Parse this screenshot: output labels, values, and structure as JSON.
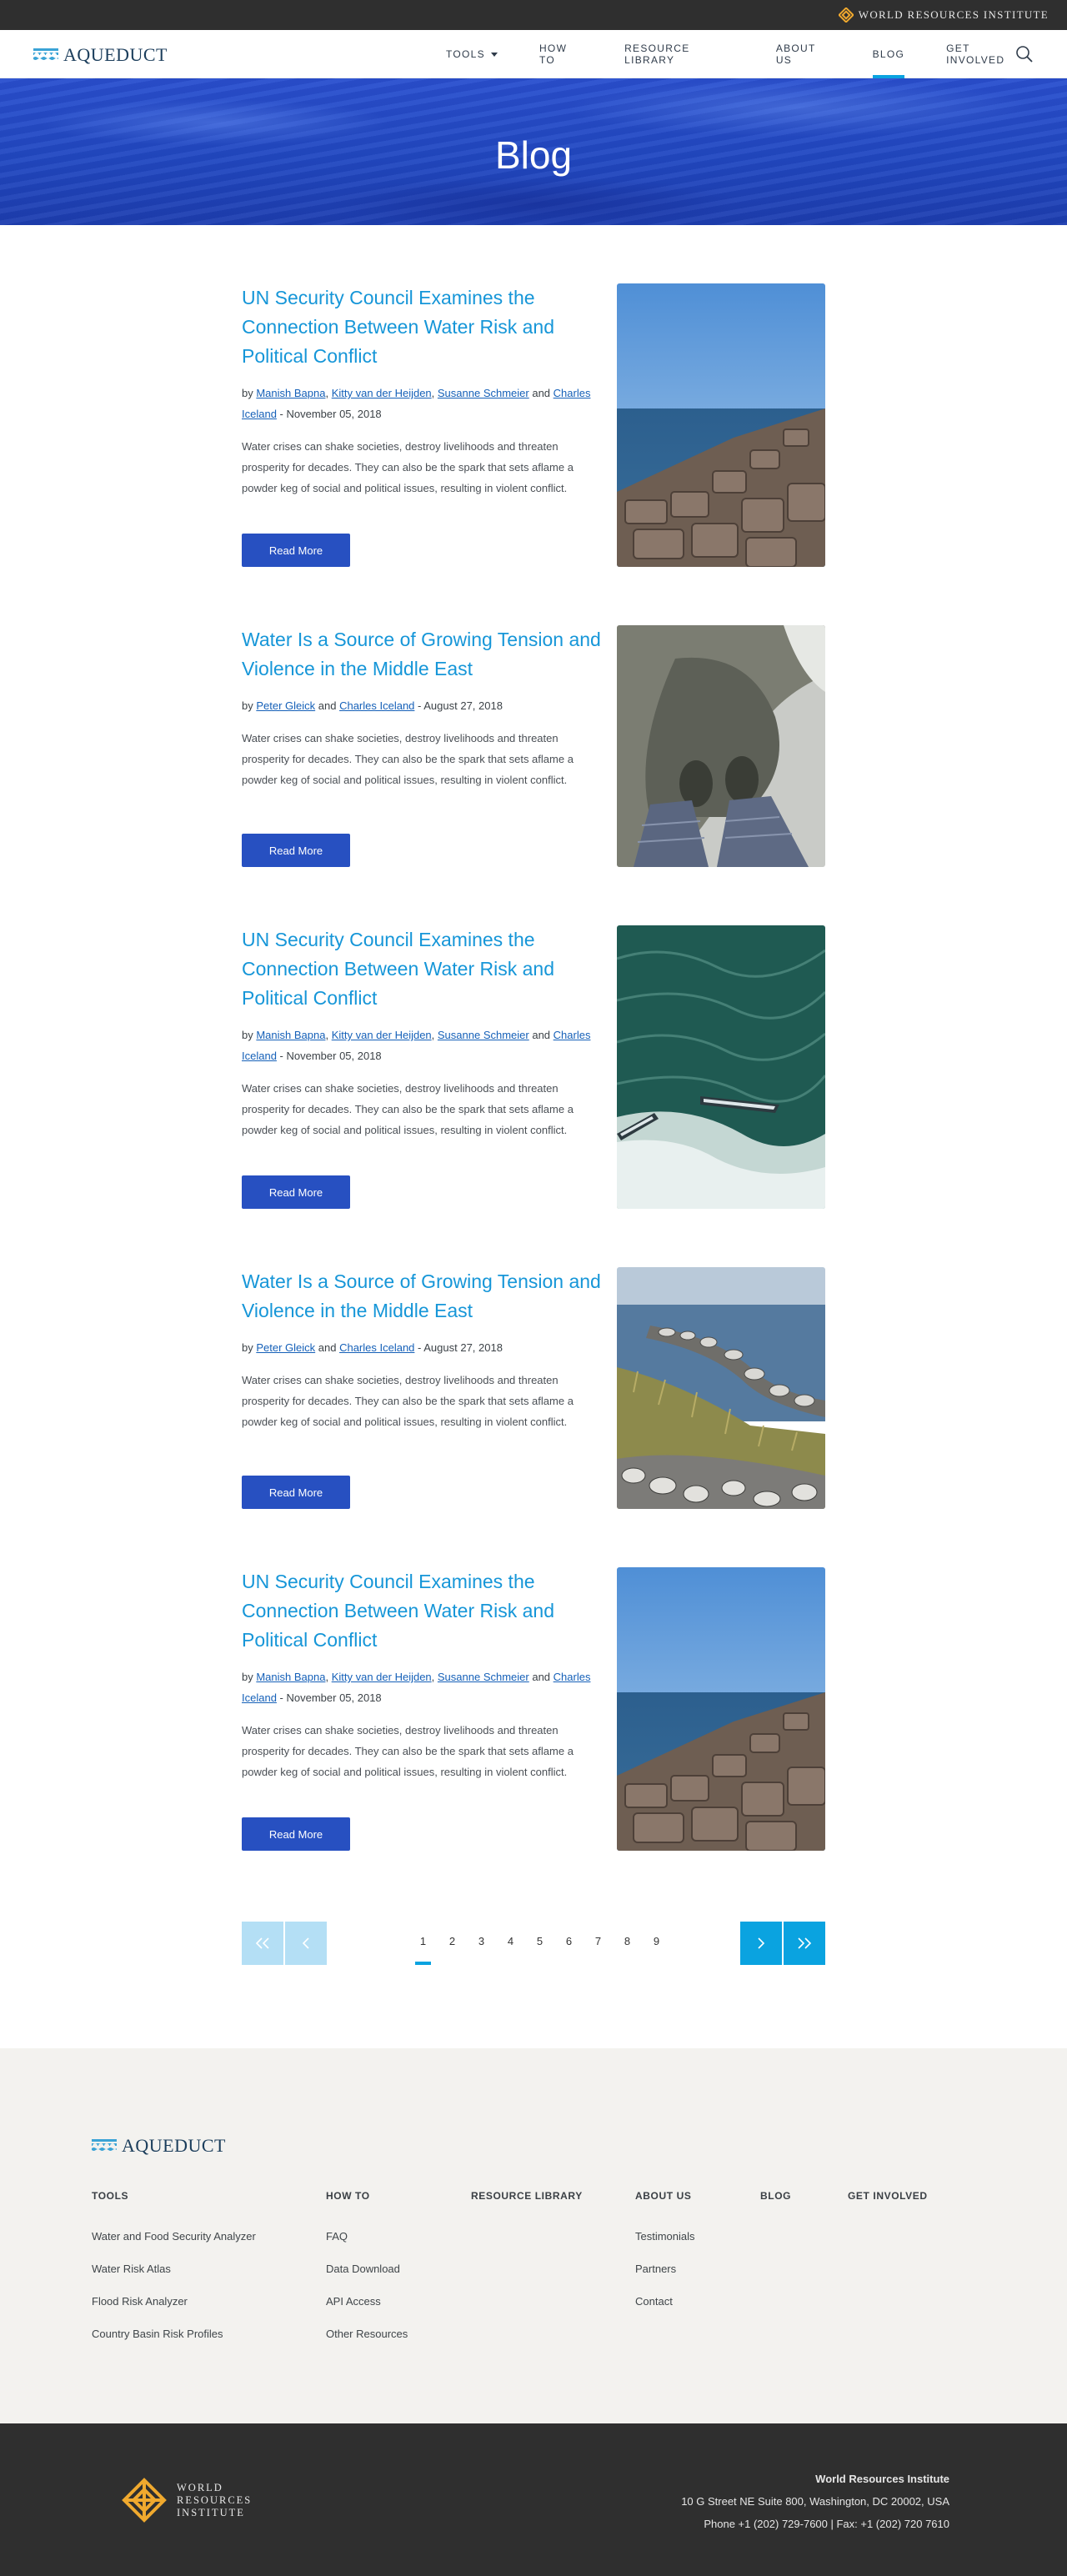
{
  "topbar": {
    "org_name": "WORLD RESOURCES INSTITUTE"
  },
  "nav": {
    "logo_text": "AQUEDUCT",
    "items": [
      {
        "label": "TOOLS"
      },
      {
        "label": "HOW TO"
      },
      {
        "label": "RESOURCE LIBRARY"
      },
      {
        "label": "ABOUT US"
      },
      {
        "label": "BLOG"
      },
      {
        "label": "GET INVOLVED"
      }
    ],
    "active": "BLOG"
  },
  "hero": {
    "title": "Blog"
  },
  "posts": [
    {
      "title": "UN Security Council Examines the Connection Between Water Risk and Political Conflict",
      "authors": [
        "Manish Bapna",
        "Kitty van der Heijden",
        "Susanne Schmeier",
        "Charles Iceland"
      ],
      "date": "November 05, 2018",
      "excerpt": "Water crises can shake societies, destroy livelihoods and threaten prosperity for decades. They can also be the spark that sets aflame a powder keg of social and political issues, resulting in violent conflict.",
      "button": "Read More",
      "image": "rocky-jetty-photo"
    },
    {
      "title": "Water Is a Source of Growing Tension and Violence in the Middle East",
      "authors": [
        "Peter Gleick",
        "Charles Iceland"
      ],
      "date": "August 27, 2018",
      "excerpt": "Water crises can shake societies, destroy livelihoods and threaten prosperity for decades. They can also be the spark that sets aflame a powder keg of social and political issues, resulting in violent conflict.",
      "button": "Read More",
      "image": "feet-in-water-photo"
    },
    {
      "title": "UN Security Council Examines the Connection Between Water Risk and Political Conflict",
      "authors": [
        "Manish Bapna",
        "Kitty van der Heijden",
        "Susanne Schmeier",
        "Charles Iceland"
      ],
      "date": "November 05, 2018",
      "excerpt": "Water crises can shake societies, destroy livelihoods and threaten prosperity for decades. They can also be the spark that sets aflame a powder keg of social and political issues, resulting in violent conflict.",
      "button": "Read More",
      "image": "boats-aerial-photo"
    },
    {
      "title": "Water Is a Source of Growing Tension and Violence in the Middle East",
      "authors": [
        "Peter Gleick",
        "Charles Iceland"
      ],
      "date": "August 27, 2018",
      "excerpt": "Water crises can shake societies, destroy livelihoods and threaten prosperity for decades. They can also be the spark that sets aflame a powder keg of social and political issues, resulting in violent conflict.",
      "button": "Read More",
      "image": "coastal-breakwater-photo"
    },
    {
      "title": "UN Security Council Examines the Connection Between Water Risk and Political Conflict",
      "authors": [
        "Manish Bapna",
        "Kitty van der Heijden",
        "Susanne Schmeier",
        "Charles Iceland"
      ],
      "date": "November 05, 2018",
      "excerpt": "Water crises can shake societies, destroy livelihoods and threaten prosperity for decades. They can also be the spark that sets aflame a powder keg of social and political issues, resulting in violent conflict.",
      "button": "Read More",
      "image": "rocky-jetty-photo"
    }
  ],
  "pagination": {
    "pages": [
      "1",
      "2",
      "3",
      "4",
      "5",
      "6",
      "7",
      "8",
      "9"
    ],
    "current": "1"
  },
  "footer": {
    "logo_text": "AQUEDUCT",
    "columns": [
      {
        "heading": "TOOLS",
        "links": [
          "Water and Food Security Analyzer",
          "Water Risk Atlas",
          "Flood Risk Analyzer",
          "Country Basin Risk Profiles"
        ]
      },
      {
        "heading": "HOW TO",
        "links": [
          "FAQ",
          "Data Download",
          "API Access",
          "Other Resources"
        ]
      },
      {
        "heading": "RESOURCE LIBRARY",
        "links": []
      },
      {
        "heading": "ABOUT US",
        "links": [
          "Testimonials",
          "Partners",
          "Contact"
        ]
      },
      {
        "heading": "BLOG",
        "links": []
      },
      {
        "heading": "GET INVOLVED",
        "links": []
      }
    ]
  },
  "bottom": {
    "logo_lines": [
      "WORLD",
      "RESOURCES",
      "INSTITUTE"
    ],
    "org": "World Resources Institute",
    "address": "10 G Street NE Suite 800, Washington, DC 20002, USA",
    "phone": "Phone +1 (202) 729-7600 | Fax: +1 (202) 720 7610"
  },
  "colors": {
    "accent": "#0aa3e0",
    "button": "#2750c1",
    "title": "#1696d8",
    "dark": "#2f2f2f",
    "gold": "#f0a92e"
  }
}
